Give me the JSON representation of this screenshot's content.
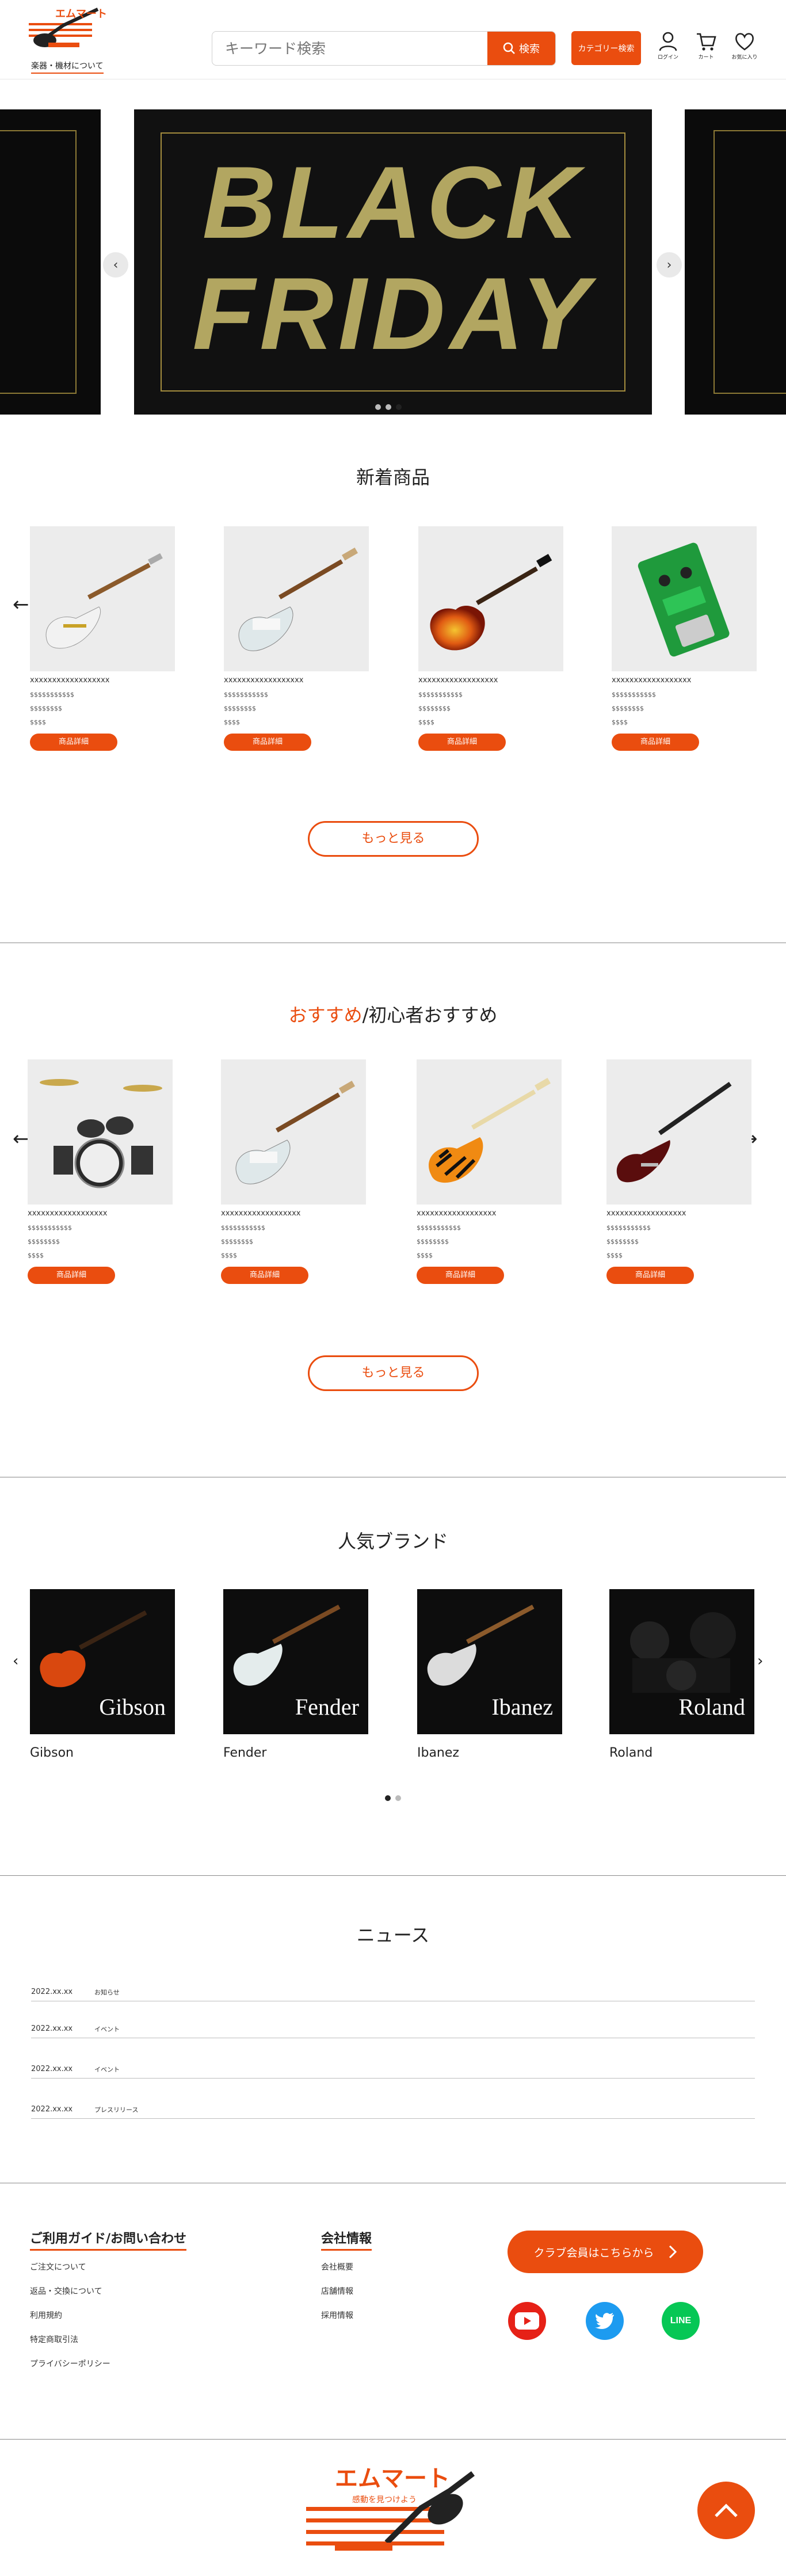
{
  "header": {
    "logo_text": "エムマート",
    "about_link": "楽器・機材について",
    "search_placeholder": "キーワード検索",
    "search_button": "検索",
    "category_button": "カテゴリー検索",
    "icons": [
      {
        "name": "user-icon",
        "label": "ログイン"
      },
      {
        "name": "cart-icon",
        "label": "カート"
      },
      {
        "name": "heart-icon",
        "label": "お気に入り"
      }
    ]
  },
  "hero": {
    "line1": "BLACK",
    "line2": "FRIDAY",
    "dots": 3,
    "active_dot": 2
  },
  "new_products": {
    "title": "新着商品",
    "items": [
      {
        "title": "xxxxxxxxxxxxxxxxxx",
        "line1": "$$$$$$$$$$$",
        "line2": "$$$$$$$$",
        "line3": "$$$$",
        "button": "商品詳細",
        "image": "white-superstrat-guitar"
      },
      {
        "title": "xxxxxxxxxxxxxxxxxx",
        "line1": "$$$$$$$$$$$",
        "line2": "$$$$$$$$",
        "line3": "$$$$",
        "button": "商品詳細",
        "image": "white-strat-guitar"
      },
      {
        "title": "xxxxxxxxxxxxxxxxxx",
        "line1": "$$$$$$$$$$$",
        "line2": "$$$$$$$$",
        "line3": "$$$$",
        "button": "商品詳細",
        "image": "sunburst-lespaul-guitar"
      },
      {
        "title": "xxxxxxxxxxxxxxxxxx",
        "line1": "$$$$$$$$$$$",
        "line2": "$$$$$$$$",
        "line3": "$$$$",
        "button": "商品詳細",
        "image": "green-effects-pedal"
      }
    ],
    "more_button": "もっと見る"
  },
  "recommend": {
    "title_accent": "おすすめ",
    "title_rest": "/初心者おすすめ",
    "items": [
      {
        "title": "xxxxxxxxxxxxxxxxxx",
        "line1": "$$$$$$$$$$$",
        "line2": "$$$$$$$$",
        "line3": "$$$$",
        "button": "商品詳細",
        "image": "drum-kit"
      },
      {
        "title": "xxxxxxxxxxxxxxxxxx",
        "line1": "$$$$$$$$$$$",
        "line2": "$$$$$$$$",
        "line3": "$$$$",
        "button": "商品詳細",
        "image": "white-strat-guitar"
      },
      {
        "title": "xxxxxxxxxxxxxxxxxx",
        "line1": "$$$$$$$$$$$",
        "line2": "$$$$$$$$",
        "line3": "$$$$",
        "button": "商品詳細",
        "image": "tiger-stripe-guitar"
      },
      {
        "title": "xxxxxxxxxxxxxxxxxx",
        "line1": "$$$$$$$$$$$",
        "line2": "$$$$$$$$",
        "line3": "$$$$",
        "button": "商品詳細",
        "image": "red-bass-guitar"
      }
    ],
    "more_button": "もっと見る"
  },
  "brands": {
    "title": "人気ブランド",
    "items": [
      {
        "name": "Gibson",
        "logo_text": "Gibson"
      },
      {
        "name": "Fender",
        "logo_text": "Fender"
      },
      {
        "name": "Ibanez",
        "logo_text": "Ibanez"
      },
      {
        "name": "Roland",
        "logo_text": "Roland"
      }
    ],
    "dots": 2,
    "active_dot": 0
  },
  "news": {
    "title": "ニュース",
    "items": [
      {
        "date": "2022.xx.xx",
        "category": "お知らせ"
      },
      {
        "date": "2022.xx.xx",
        "category": "イベント"
      },
      {
        "date": "2022.xx.xx",
        "category": "イベント"
      },
      {
        "date": "2022.xx.xx",
        "category": "プレスリリース"
      }
    ]
  },
  "footer": {
    "guide_title": "ご利用ガイド/お問い合わせ",
    "guide_links": [
      "ご注文について",
      "返品・交換について",
      "利用規約",
      "特定商取引法",
      "プライバシーポリシー"
    ],
    "company_title": "会社情報",
    "company_links": [
      "会社概要",
      "店舗情報",
      "採用情報"
    ],
    "club_button": "クラブ会員はこちらから",
    "social": [
      {
        "name": "youtube-icon",
        "color": "#e62117"
      },
      {
        "name": "twitter-icon",
        "color": "#1d9bf0"
      },
      {
        "name": "line-icon",
        "color": "#06c755",
        "label": "LINE"
      }
    ],
    "bottom_logo_text": "エムマート",
    "bottom_logo_tagline": "感動を見つけよう"
  },
  "colors": {
    "accent": "#ea4d0f"
  }
}
